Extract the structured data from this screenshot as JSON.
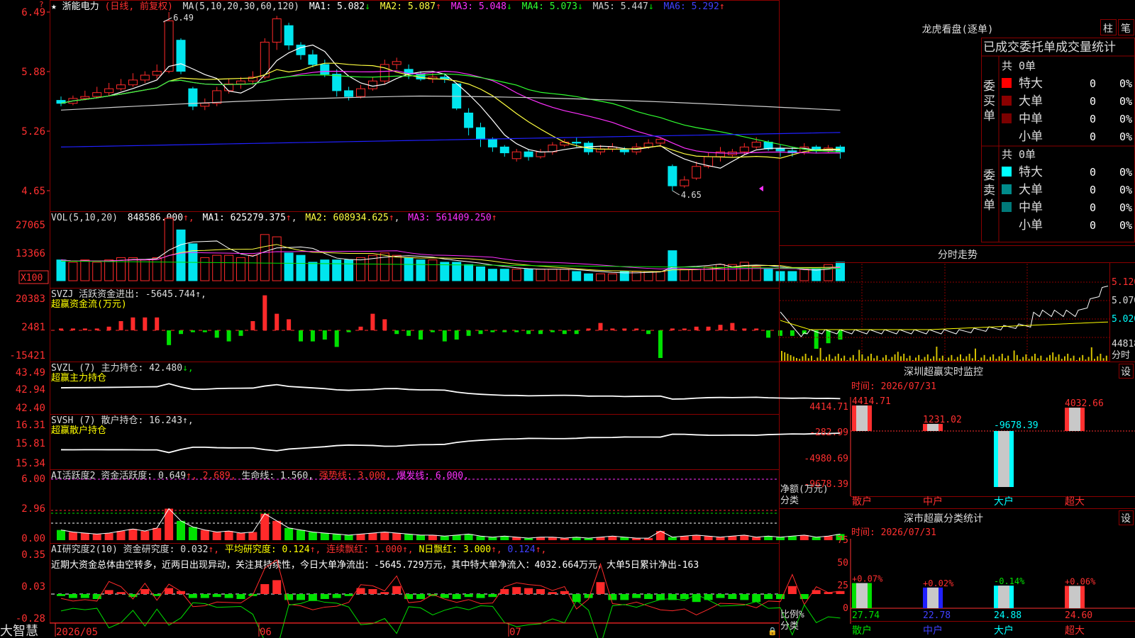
{
  "colors": {
    "up": "#ff2a2a",
    "down": "#00e5ee",
    "grid": "#8b0000",
    "axis": "#ff3030",
    "ma1": "#ffffff",
    "ma2": "#ffff40",
    "ma3": "#ff30ff",
    "ma4": "#30ff30",
    "ma5": "#cfcfcf",
    "ma6": "#2020ff",
    "green": "#00e000",
    "yellow": "#ffff00",
    "cyan": "#00ffff",
    "magenta": "#ff30ff"
  },
  "header": {
    "star": "★",
    "stock": "浙能电力",
    "mode": "(日线, 前复权)",
    "ma_spec": "MA(5,10,20,30,60,120)",
    "ma": [
      {
        "label": "MA1: 5.082",
        "arrow": "↓"
      },
      {
        "label": "MA2: 5.087",
        "arrow": "↑"
      },
      {
        "label": "MA3: 5.048",
        "arrow": "↓"
      },
      {
        "label": "MA4: 5.073",
        "arrow": "↓"
      },
      {
        "label": "MA5: 5.447",
        "arrow": "↓"
      },
      {
        "label": "MA6: 5.292",
        "arrow": "↑"
      }
    ]
  },
  "price_axis": [
    "6.49",
    "5.88",
    "5.26",
    "4.65"
  ],
  "price_marks": {
    "high": "6.49",
    "low": "4.65"
  },
  "vol": {
    "title": "VOL(5,10,20)",
    "value": "848586.000",
    "ma": [
      {
        "label": "MA1: 625279.375",
        "arrow": "↑"
      },
      {
        "label": "MA2: 608934.625",
        "arrow": "↑"
      },
      {
        "label": "MA3: 561409.250",
        "arrow": "↑"
      }
    ],
    "axis": [
      "27065",
      "13366"
    ],
    "unit": "X100"
  },
  "svzj": {
    "line1": "SVZJ  活跃资金进出: -5645.744↑,",
    "line2": "超赢资金流(万元)",
    "axis": [
      "20383",
      "2481",
      "-15421"
    ]
  },
  "svzl": {
    "line1_a": "SVZL (7) 主力持仓: 42.480",
    "arrow": "↓,",
    "line2": "超赢主力持仓",
    "axis": [
      "43.49",
      "42.94",
      "42.40"
    ]
  },
  "svsh": {
    "line1": "SVSH (7) 散户持仓: 16.243↑,",
    "line2": "超赢散户持仓",
    "axis": [
      "16.31",
      "15.81",
      "15.34"
    ]
  },
  "ai1": {
    "a": "AI活跃度2 资金活跃度: 0.649",
    "b": "↑, 2.689,",
    "c": " 生命线: 1.560,",
    "d": " 强势线: 3.000,",
    "e": " 爆发线: 6.000,",
    "axis": [
      "6.00",
      "2.96",
      "0.00"
    ]
  },
  "ai2": {
    "a": "AI研究度2(10) 资金研究度: 0.032",
    "b": "↑,",
    "c": " 平均研究度: 0.124",
    "d": "↑,",
    "e": " 连续飘红: 1.000",
    "f": "↑,",
    "g": " N日飘红: 3.000",
    "h": "↑,",
    "i": " 0.124",
    "j": "↑,",
    "comment": "近期大资金总体由空转多，近两日出现异动，关注其持续性，今日大单净流出：-5645.729万元，其中特大单净流入：4032.664万元，大单5日累计净出-163",
    "axis": [
      "0.35",
      "0.03",
      "-0.28"
    ]
  },
  "dates": [
    "2026/05",
    "06",
    "07"
  ],
  "brand": "大智慧",
  "right": {
    "lhk_title": "龙虎看盘(逐单)",
    "btn_zhu": "柱",
    "btn_bi": "笔",
    "stat_title": "已成交委托单成交量统计",
    "buy": {
      "label": [
        "委",
        "买",
        "单"
      ],
      "total": "共 0单",
      "rows": [
        {
          "name": "特大",
          "v": "0",
          "p": "0%",
          "c": "#ff0000"
        },
        {
          "name": "大单",
          "v": "0",
          "p": "0%",
          "c": "#8b0000"
        },
        {
          "name": "中单",
          "v": "0",
          "p": "0%",
          "c": "#7a0000"
        },
        {
          "name": "小单",
          "v": "0",
          "p": "0%",
          "c": ""
        }
      ]
    },
    "sell": {
      "label": [
        "委",
        "卖",
        "单"
      ],
      "total": "共 0单",
      "rows": [
        {
          "name": "特大",
          "v": "0",
          "p": "0%",
          "c": "#00ffff"
        },
        {
          "name": "大单",
          "v": "0",
          "p": "0%",
          "c": "#008b8b"
        },
        {
          "name": "中单",
          "v": "0",
          "p": "0%",
          "c": "#007a7a"
        },
        {
          "name": "小单",
          "v": "0",
          "p": "0%",
          "c": ""
        }
      ]
    },
    "fenshi_title": "分时走势",
    "fenshi_axis": [
      "5.120",
      "5.070",
      "5.020"
    ],
    "fenshi_vol": "44818",
    "fenshi_unit": "分时",
    "sz_title": "深圳超赢实时监控",
    "sz_time": "时间: 2026/07/31",
    "sz_axis": [
      "4414.71",
      "-282.99",
      "-4980.69",
      "-9678.39"
    ],
    "sz_unit": "净额(万元)",
    "sz_cat_label": "分类",
    "sz_bars": [
      {
        "cat": "散户",
        "label": "4414.71",
        "value": 4414.71
      },
      {
        "cat": "中户",
        "label": "1231.02",
        "value": 1231.02
      },
      {
        "cat": "大户",
        "label": "-9678.39",
        "value": -9678.39
      },
      {
        "cat": "超大",
        "label": "4032.66",
        "value": 4032.66
      }
    ],
    "sm_title": "深市超赢分类统计",
    "sm_time": "时间: 2026/07/31",
    "sm_axis": [
      "75",
      "50",
      "25",
      "0"
    ],
    "sm_unit": "比例%",
    "sm_cat_label": "分类",
    "sm_bars": [
      {
        "cat": "散户",
        "top": "+0.07%",
        "value": 27.74,
        "label": "27.74"
      },
      {
        "cat": "中户",
        "top": "+0.02%",
        "value": 22.78,
        "label": "22.78"
      },
      {
        "cat": "大户",
        "top": "-0.14%",
        "value": 24.88,
        "label": "24.88"
      },
      {
        "cat": "超大",
        "top": "+0.06%",
        "value": 24.6,
        "label": "24.60"
      }
    ],
    "settings": "设"
  },
  "chart_data": {
    "type": "candlestick",
    "ylim": [
      4.65,
      6.49
    ],
    "note_high": "6.49",
    "note_low": "4.65",
    "candles": [
      [
        5.58,
        5.55,
        5.62,
        5.52
      ],
      [
        5.55,
        5.6,
        5.63,
        5.53
      ],
      [
        5.6,
        5.62,
        5.68,
        5.58
      ],
      [
        5.62,
        5.66,
        5.72,
        5.6
      ],
      [
        5.66,
        5.7,
        5.76,
        5.63
      ],
      [
        5.7,
        5.74,
        5.8,
        5.68
      ],
      [
        5.74,
        5.79,
        5.86,
        5.72
      ],
      [
        5.79,
        5.84,
        5.88,
        5.76
      ],
      [
        5.84,
        5.88,
        5.95,
        5.8
      ],
      [
        5.88,
        6.4,
        6.49,
        5.86
      ],
      [
        6.2,
        5.88,
        6.22,
        5.85
      ],
      [
        5.7,
        5.52,
        5.72,
        5.48
      ],
      [
        5.52,
        5.55,
        5.6,
        5.48
      ],
      [
        5.55,
        5.68,
        5.72,
        5.52
      ],
      [
        5.68,
        5.75,
        5.8,
        5.65
      ],
      [
        5.75,
        5.78,
        5.82,
        5.7
      ],
      [
        5.78,
        5.82,
        5.88,
        5.74
      ],
      [
        5.82,
        6.18,
        6.22,
        5.8
      ],
      [
        6.18,
        6.42,
        6.45,
        6.1
      ],
      [
        6.35,
        6.15,
        6.38,
        6.1
      ],
      [
        6.15,
        6.05,
        6.18,
        6.0
      ],
      [
        6.05,
        5.95,
        6.1,
        5.92
      ],
      [
        5.95,
        5.85,
        6.0,
        5.82
      ],
      [
        5.85,
        5.68,
        5.9,
        5.62
      ],
      [
        5.68,
        5.62,
        5.72,
        5.58
      ],
      [
        5.62,
        5.7,
        5.74,
        5.6
      ],
      [
        5.7,
        5.78,
        5.82,
        5.68
      ],
      [
        5.78,
        5.95,
        6.0,
        5.75
      ],
      [
        5.95,
        5.98,
        6.02,
        5.9
      ],
      [
        5.9,
        5.85,
        5.95,
        5.8
      ],
      [
        5.85,
        5.8,
        5.88,
        5.78
      ],
      [
        5.8,
        5.82,
        5.86,
        5.76
      ],
      [
        5.82,
        5.8,
        5.86,
        5.76
      ],
      [
        5.75,
        5.5,
        5.76,
        5.48
      ],
      [
        5.45,
        5.3,
        5.5,
        5.22
      ],
      [
        5.3,
        5.18,
        5.35,
        5.1
      ],
      [
        5.18,
        5.1,
        5.2,
        5.05
      ],
      [
        5.1,
        5.04,
        5.12,
        5.0
      ],
      [
        4.98,
        5.05,
        5.08,
        4.95
      ],
      [
        5.05,
        5.0,
        5.08,
        4.96
      ],
      [
        5.0,
        5.05,
        5.08,
        4.98
      ],
      [
        5.05,
        5.12,
        5.15,
        5.02
      ],
      [
        5.12,
        5.15,
        5.18,
        5.1
      ],
      [
        5.15,
        5.14,
        5.2,
        5.1
      ],
      [
        5.14,
        5.05,
        5.16,
        5.02
      ],
      [
        5.05,
        5.08,
        5.12,
        5.02
      ],
      [
        5.08,
        5.1,
        5.14,
        5.05
      ],
      [
        5.07,
        5.05,
        5.1,
        5.02
      ],
      [
        5.05,
        5.1,
        5.14,
        5.02
      ],
      [
        5.1,
        5.14,
        5.18,
        5.08
      ],
      [
        5.14,
        5.18,
        5.2,
        5.1
      ],
      [
        4.9,
        4.7,
        4.92,
        4.65
      ],
      [
        4.7,
        4.76,
        4.8,
        4.68
      ],
      [
        4.78,
        4.9,
        4.95,
        4.76
      ],
      [
        4.9,
        5.0,
        5.04,
        4.88
      ],
      [
        5.0,
        5.05,
        5.1,
        4.95
      ],
      [
        5.02,
        5.05,
        5.08,
        5.0
      ],
      [
        5.05,
        5.1,
        5.14,
        5.02
      ],
      [
        5.1,
        5.15,
        5.2,
        5.08
      ],
      [
        5.15,
        5.08,
        5.17,
        5.06
      ],
      [
        5.08,
        5.06,
        5.12,
        5.0
      ],
      [
        5.06,
        5.04,
        5.1,
        5.0
      ],
      [
        5.04,
        5.1,
        5.14,
        5.02
      ],
      [
        5.1,
        5.06,
        5.12,
        5.04
      ],
      [
        5.06,
        5.09,
        5.12,
        5.04
      ],
      [
        5.1,
        5.05,
        5.12,
        4.98
      ]
    ],
    "vol": [
      9,
      8,
      9,
      8,
      9,
      10,
      10,
      9,
      10,
      27,
      22,
      16,
      10,
      11,
      11,
      10,
      11,
      20,
      19,
      12,
      11,
      8,
      9,
      9,
      9,
      10,
      11,
      12,
      11,
      10,
      9,
      9,
      8,
      8,
      7,
      6,
      5,
      5,
      5,
      5,
      5,
      5,
      5,
      4,
      3,
      3,
      3,
      4,
      4,
      4,
      4,
      13,
      5,
      5,
      6,
      7,
      7,
      8,
      6,
      5,
      4,
      4,
      5,
      5,
      7,
      8
    ],
    "flow": [
      1,
      1,
      1,
      1,
      2,
      5,
      7,
      7,
      7,
      -8,
      -2,
      -1,
      -1,
      -4,
      -6,
      -3,
      5,
      19,
      9,
      6,
      -6,
      -6,
      -5,
      -9,
      -1,
      2,
      9,
      6,
      -2,
      -3,
      -5,
      -1,
      -6,
      -5,
      -3,
      -2,
      -1,
      -1,
      -1,
      -2,
      -2,
      -1,
      -2,
      -2,
      1,
      4,
      1,
      1,
      1,
      -2,
      -15,
      1,
      1,
      2,
      2,
      3,
      4,
      1,
      1,
      -4,
      -3,
      -3,
      -2,
      -10,
      -7,
      -5
    ],
    "ai1": [
      1.0,
      0.8,
      0.7,
      0.6,
      0.7,
      0.9,
      1.1,
      0.9,
      1.2,
      3.1,
      1.9,
      1.3,
      1.0,
      0.8,
      0.9,
      0.7,
      0.8,
      2.6,
      1.9,
      1.2,
      1.0,
      0.8,
      0.7,
      0.6,
      0.5,
      0.6,
      0.7,
      0.8,
      0.7,
      0.6,
      0.5,
      0.5,
      0.4,
      0.5,
      0.6,
      0.4,
      0.3,
      0.4,
      0.3,
      0.2,
      0.3,
      0.3,
      0.2,
      0.3,
      0.2,
      0.3,
      0.4,
      0.3,
      0.2,
      0.2,
      0.9,
      0.3,
      0.4,
      0.5,
      0.4,
      0.3,
      0.4,
      0.5,
      0.3,
      0.4,
      0.3,
      0.4,
      0.5,
      0.3,
      0.4,
      0.6
    ],
    "ai2": [
      -0.02,
      -0.04,
      -0.04,
      -0.05,
      0.04,
      0.02,
      -0.03,
      0.05,
      -0.02,
      0.06,
      0.03,
      -0.04,
      -0.04,
      -0.03,
      -0.04,
      -0.05,
      -0.02,
      0.1,
      0.14,
      -0.06,
      -0.06,
      -0.07,
      -0.05,
      -0.04,
      -0.02,
      0.06,
      0.05,
      0.02,
      0.08,
      -0.05,
      -0.05,
      -0.02,
      -0.04,
      -0.05,
      -0.03,
      -0.04,
      -0.03,
      0.05,
      0.07,
      0.06,
      0.05,
      0.02,
      0.03,
      -0.08,
      -0.04,
      0.12,
      -0.06,
      -0.06,
      -0.04,
      -0.05,
      -0.06,
      -0.06,
      -0.05,
      -0.08,
      -0.06,
      -0.04,
      -0.05,
      -0.06,
      -0.08,
      -0.05,
      -0.05,
      0.08,
      -0.05,
      0.04,
      0.02,
      0.03
    ]
  }
}
